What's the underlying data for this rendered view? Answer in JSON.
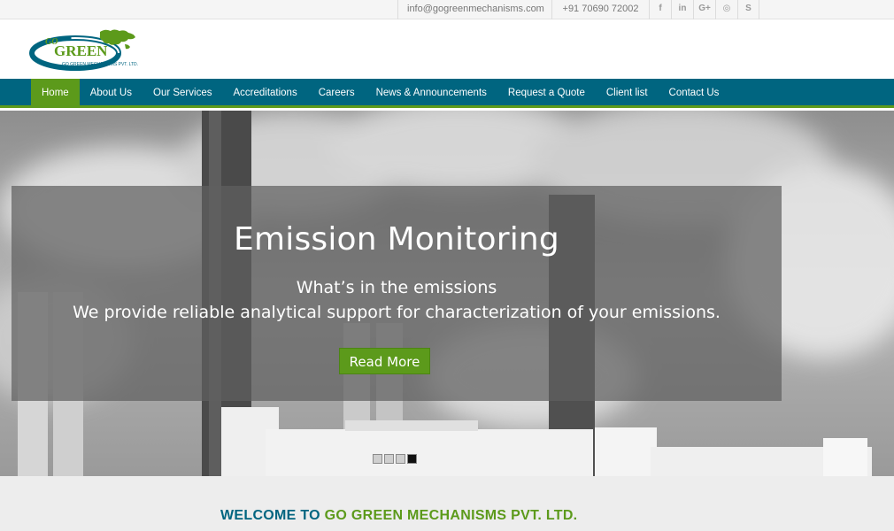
{
  "topbar": {
    "email": "info@gogreenmechanisms.com",
    "phone": "+91 70690 72002",
    "social": [
      {
        "icon": "facebook-icon",
        "glyph": "f"
      },
      {
        "icon": "linkedin-icon",
        "glyph": "in"
      },
      {
        "icon": "google-plus-icon",
        "glyph": "G+"
      },
      {
        "icon": "instagram-icon",
        "glyph": "◎"
      },
      {
        "icon": "skype-icon",
        "glyph": "S"
      }
    ]
  },
  "logo": {
    "top_text": "GO",
    "main_text": "GREEN",
    "tagline": "GO GREEN MECHANISMS PVT. LTD."
  },
  "nav": {
    "items": [
      {
        "label": "Home",
        "active": true
      },
      {
        "label": "About Us"
      },
      {
        "label": "Our Services"
      },
      {
        "label": "Accreditations"
      },
      {
        "label": "Careers"
      },
      {
        "label": "News & Announcements"
      },
      {
        "label": "Request a Quote"
      },
      {
        "label": "Client list"
      },
      {
        "label": "Contact Us"
      }
    ]
  },
  "hero": {
    "title": "Emission Monitoring",
    "subtitle_1": "What’s in the emissions",
    "subtitle_2": "We provide reliable analytical support for characterization of your emissions.",
    "button_label": "Read More",
    "slides_total": 4,
    "active_slide": 4
  },
  "welcome": {
    "part1": "WELCOME TO ",
    "part2": "GO GREEN MECHANISMS PVT. LTD."
  },
  "colors": {
    "brand_blue": "#006580",
    "brand_green": "#5c9a1b"
  }
}
